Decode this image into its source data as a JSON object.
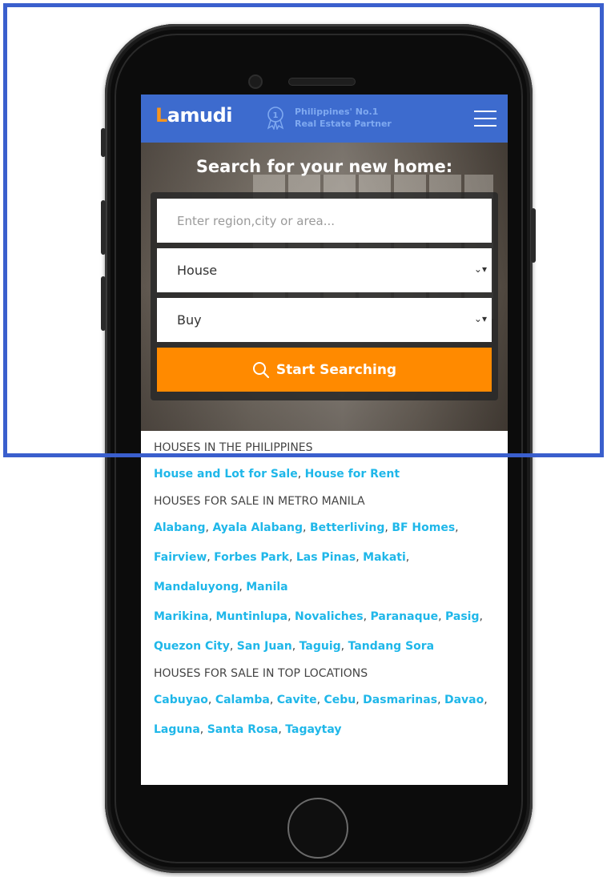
{
  "header": {
    "logo_first": "L",
    "logo_rest": "amudi",
    "tagline_line1": "Philippines' No.1",
    "tagline_line2": "Real Estate Partner"
  },
  "hero": {
    "title": "Search for your new home:"
  },
  "search": {
    "location_placeholder": "Enter region,city or area...",
    "property_type": "House",
    "offer_type": "Buy",
    "button_label": "Start Searching"
  },
  "sections": {
    "houses_heading": "HOUSES IN THE PHILIPPINES",
    "houses_links": [
      "House and Lot for Sale",
      "House for Rent"
    ],
    "metro_heading": "HOUSES FOR SALE IN METRO MANILA",
    "metro_links_row1": [
      "Alabang",
      "Ayala Alabang",
      "Betterliving",
      "BF Homes"
    ],
    "metro_links_row2": [
      "Fairview",
      "Forbes Park",
      "Las Pinas",
      "Makati"
    ],
    "metro_links_row3": [
      "Mandaluyong",
      "Manila"
    ],
    "metro_links_row4": [
      "Marikina",
      "Muntinlupa",
      "Novaliches",
      "Paranaque",
      "Pasig"
    ],
    "metro_links_row5": [
      "Quezon City",
      "San Juan",
      "Taguig",
      "Tandang Sora"
    ],
    "top_heading": "HOUSES FOR SALE IN TOP LOCATIONS",
    "top_links_row1": [
      "Cabuyao",
      "Calamba",
      "Cavite",
      "Cebu",
      "Dasmarinas",
      "Davao"
    ],
    "top_links_row2": [
      "Laguna",
      "Santa Rosa",
      "Tagaytay"
    ]
  },
  "colors": {
    "header_bg": "#3d6bce",
    "accent_orange": "#ff8a00",
    "link_blue": "#1fb7e9",
    "highlight_frame": "#3a5fcd"
  }
}
